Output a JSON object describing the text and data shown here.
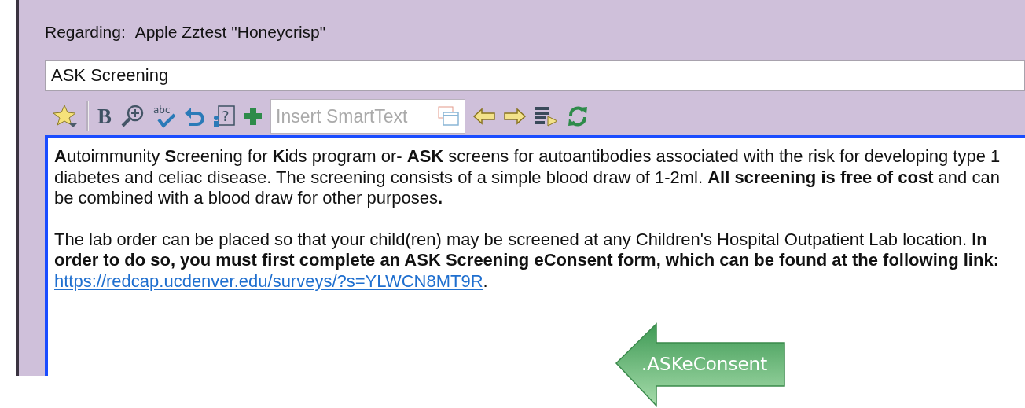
{
  "regarding": {
    "label": "Regarding:",
    "value": "Apple Zztest \"Honeycrisp\""
  },
  "title_field": {
    "value": "ASK Screening"
  },
  "toolbar": [
    {
      "kind": "star"
    },
    {
      "kind": "separator"
    },
    {
      "kind": "bold",
      "glyph": "B"
    },
    {
      "kind": "zoom"
    },
    {
      "kind": "spell",
      "glyph": "abc"
    },
    {
      "kind": "undo"
    },
    {
      "kind": "help",
      "glyph": "?"
    },
    {
      "kind": "plus"
    },
    {
      "kind": "smarttext",
      "placeholder": "Insert SmartText"
    },
    {
      "kind": "left"
    },
    {
      "kind": "right"
    },
    {
      "kind": "list"
    },
    {
      "kind": "refresh"
    }
  ],
  "paragraphs": [
    {
      "text": "**A**utoimmunity **S**creening for **K**ids program or- **ASK** screens for autoantibodies associated with the risk for developing type 1 diabetes and celiac disease. The screening consists of a simple blood draw of 1-2ml. **All screening is free of cost** and can be combined with a blood draw for other purposes**.**"
    },
    {
      "text": "The lab order can be placed so that your child(ren) may be screened at any Children's Hospital Outpatient Lab location. **In order to do so, you must first complete an ASK Screening eConsent form, which can be found at the following link:**",
      "link": "https://redcap.ucdenver.edu/surveys/?s=YLWCN8MT9R",
      "after": "."
    }
  ],
  "callout": {
    "text": ".ASKeConsent"
  }
}
